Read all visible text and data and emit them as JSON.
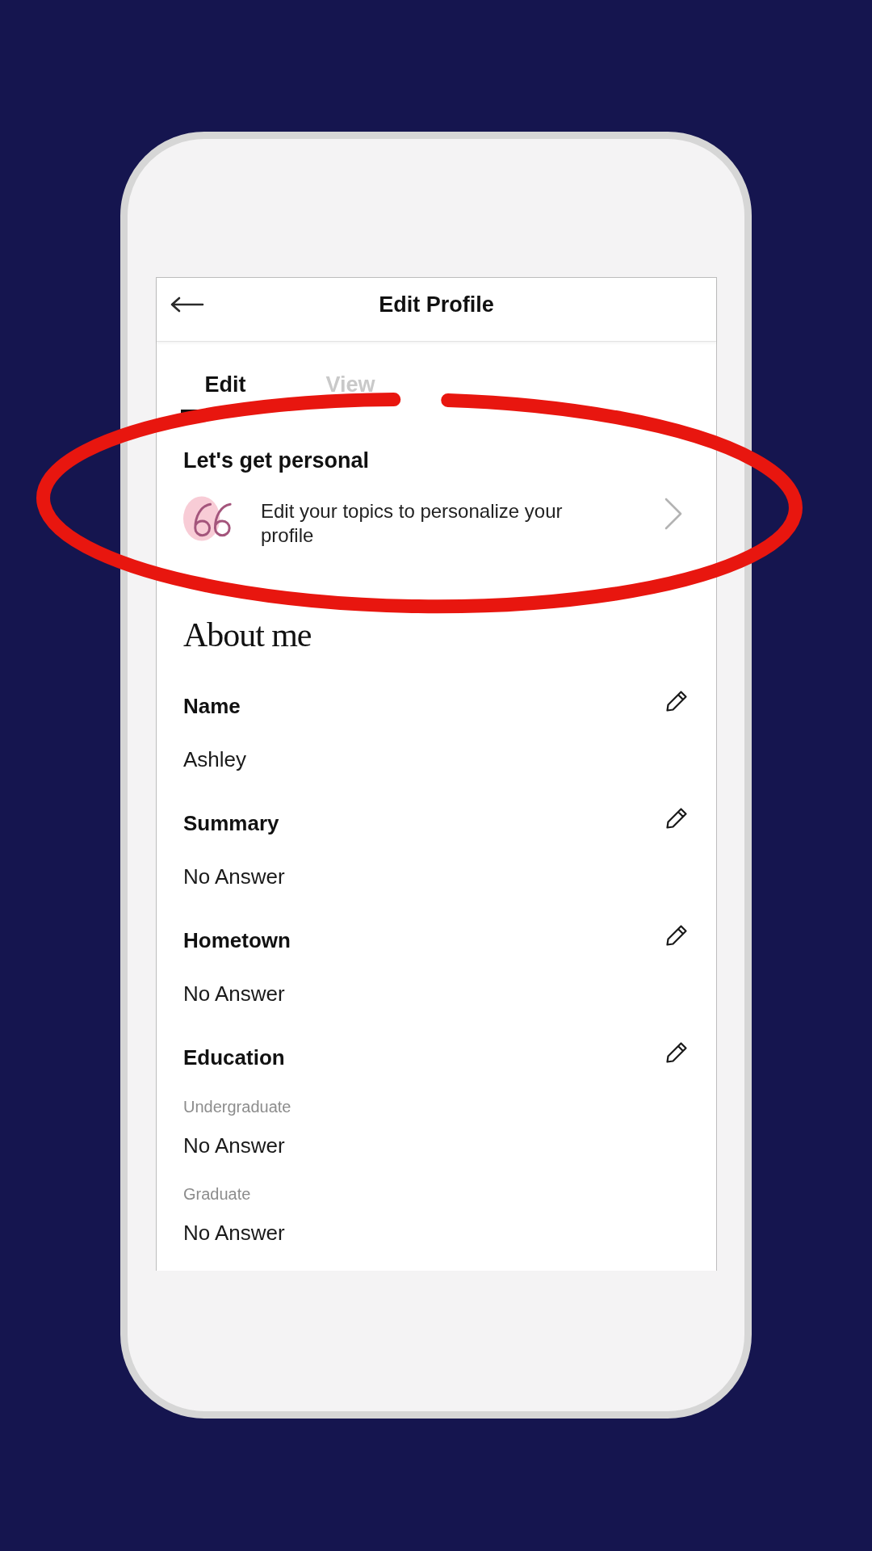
{
  "header": {
    "title": "Edit Profile"
  },
  "tabs": [
    {
      "label": "Edit",
      "selected": true
    },
    {
      "label": "View",
      "selected": false
    }
  ],
  "personalize": {
    "heading": "Let's get personal",
    "text": "Edit your topics to personalize your profile"
  },
  "about": {
    "heading": "About me",
    "fields": [
      {
        "kind": "single",
        "label": "Name",
        "value": "Ashley"
      },
      {
        "kind": "single",
        "label": "Summary",
        "value": "No Answer"
      },
      {
        "kind": "single",
        "label": "Hometown",
        "value": "No Answer"
      },
      {
        "kind": "grouped",
        "label": "Education",
        "entries": [
          {
            "label": "Undergraduate",
            "value": "No Answer"
          },
          {
            "label": "Graduate",
            "value": "No Answer"
          }
        ]
      }
    ]
  }
}
